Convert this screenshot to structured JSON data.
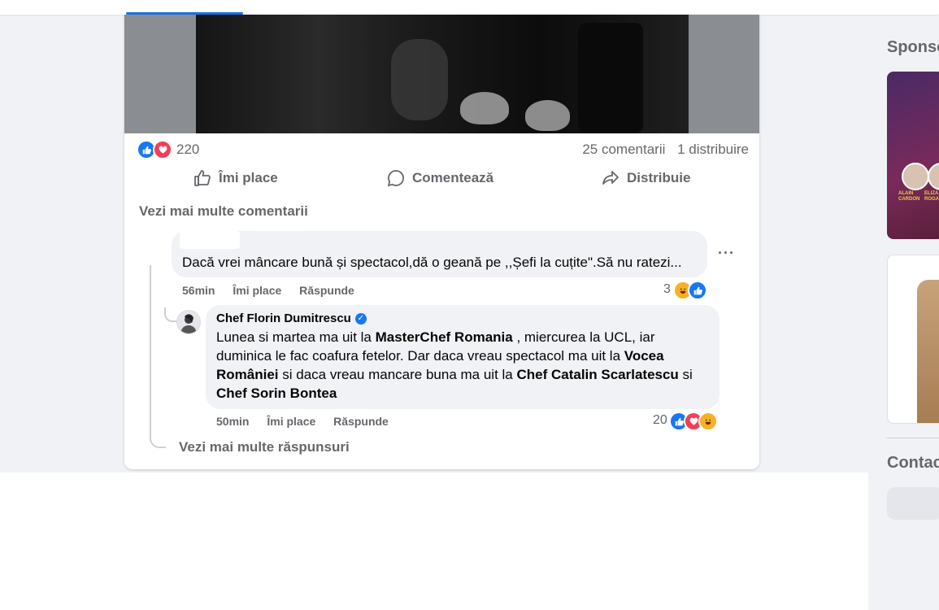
{
  "post": {
    "reactions_count": "220",
    "comments_count": "25 comentarii",
    "shares_count": "1 distribuire",
    "actions": {
      "like": "Îmi place",
      "comment": "Comentează",
      "share": "Distribuie"
    },
    "view_more_comments": "Vezi mai multe comentarii"
  },
  "comment1": {
    "text": "Dacă vrei mâncare bună și spectacol,dă o geană pe ,,Șefi la cuțite\".Să nu ratezi...",
    "time": "56min",
    "like": "Îmi place",
    "reply": "Răspunde",
    "reaction_count": "3"
  },
  "reply1": {
    "author": "Chef Florin Dumitrescu",
    "t1": "Lunea si martea ma uit la ",
    "b1": "MasterChef Romania",
    "t2": " , miercurea la UCL, iar duminica le fac coafura fetelor. Dar daca vreau spectacol ma uit la ",
    "b2": "Vocea României",
    "t3": " si daca vreau mancare buna ma uit la ",
    "b3": "Chef Catalin Scarlatescu",
    "t4": " si ",
    "b4": "Chef Sorin Bontea",
    "time": "50min",
    "like": "Îmi place",
    "reply": "Răspunde",
    "reaction_count": "20"
  },
  "view_more_replies": "Vezi mai multe răspunsuri",
  "sidebar": {
    "sponsored": "Sponso",
    "contacts": "Contac",
    "ad1_name1": "ALAIN",
    "ad1_name2": "CARDON",
    "ad1_name3": "ELIZA",
    "ad1_name4": "ROGA"
  },
  "colors": {
    "accent": "#1b74e4",
    "like": "#1877f2",
    "love": "#f33e58",
    "haha": "#f7b125"
  }
}
